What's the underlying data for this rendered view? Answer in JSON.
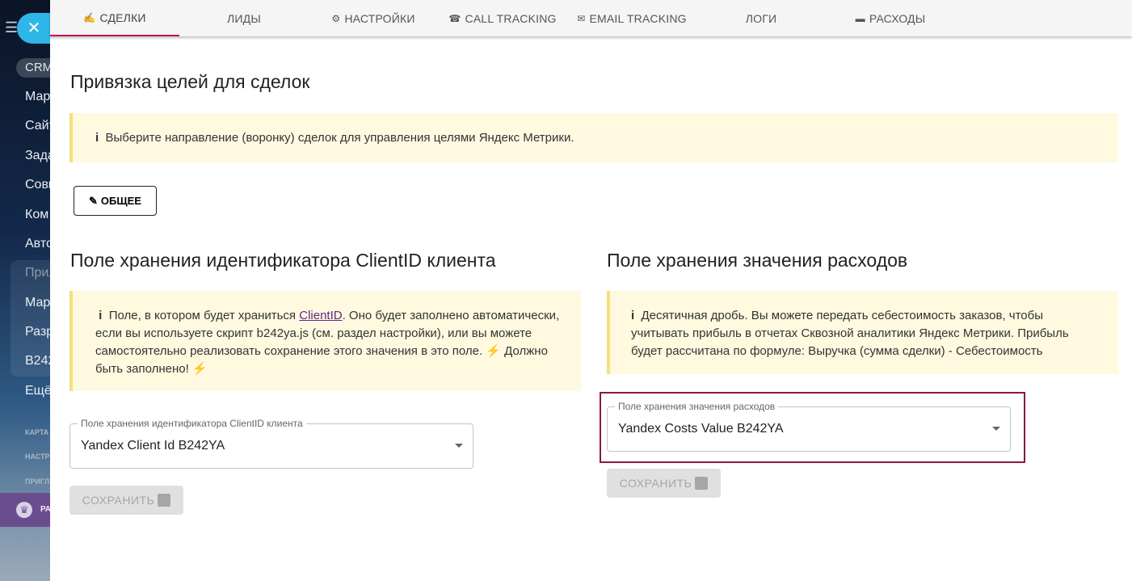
{
  "sidebar": {
    "crm": "CRM",
    "items": [
      "Мар",
      "Сайт",
      "Зада",
      "Совм",
      "Ком",
      "Авто",
      "Прил",
      "Мар",
      "Разр",
      "B242",
      "Ещё"
    ],
    "small": [
      "КАРТА",
      "НАСТР",
      "ПРИГЛ"
    ],
    "promo": "РА"
  },
  "tabs": [
    {
      "icon": "✍",
      "label": "СДЕЛКИ"
    },
    {
      "icon": "",
      "label": "ЛИДЫ"
    },
    {
      "icon": "⚙",
      "label": "НАСТРОЙКИ"
    },
    {
      "icon": "☎",
      "label": "CALL TRACKING"
    },
    {
      "icon": "✉",
      "label": "EMAIL TRACKING"
    },
    {
      "icon": "",
      "label": "ЛОГИ"
    },
    {
      "icon": "▬",
      "label": "РАСХОДЫ"
    }
  ],
  "page": {
    "title": "Привязка целей для сделок",
    "info": "Выберите направление (воронку) сделок для управления целями Яндекс Метрики.",
    "funnel_button": "ОБЩЕЕ"
  },
  "left": {
    "title": "Поле хранения идентификатора ClientID клиента",
    "info_pre": "Поле, в котором будет храниться ",
    "info_link": "ClientID",
    "info_post": ". Оно будет заполнено автоматически, если вы используете скрипт b242ya.js (см. раздел настройки), или вы можете самостоятельно реализовать сохранение этого значения в это поле. ⚡ Должно быть заполнено! ⚡",
    "field_label": "Поле хранения идентификатора ClientID клиента",
    "field_value": "Yandex Client Id B242YA",
    "save": "СОХРАНИТЬ"
  },
  "right": {
    "title": "Поле хранения значения расходов",
    "info": "Десятичная дробь. Вы можете передать себестоимость заказов, чтобы учитывать прибыль в отчетах Сквозной аналитики Яндекс Метрики. Прибыль будет рассчитана по формуле: Выручка (сумма сделки) - Себестоимость",
    "field_label": "Поле хранения значения расходов",
    "field_value": "Yandex Costs Value B242YA",
    "save": "СОХРАНИТЬ"
  },
  "colors": {
    "accent": "#c2185b",
    "alert_bg": "#fff9e0",
    "highlight": "#8b1a3a"
  }
}
